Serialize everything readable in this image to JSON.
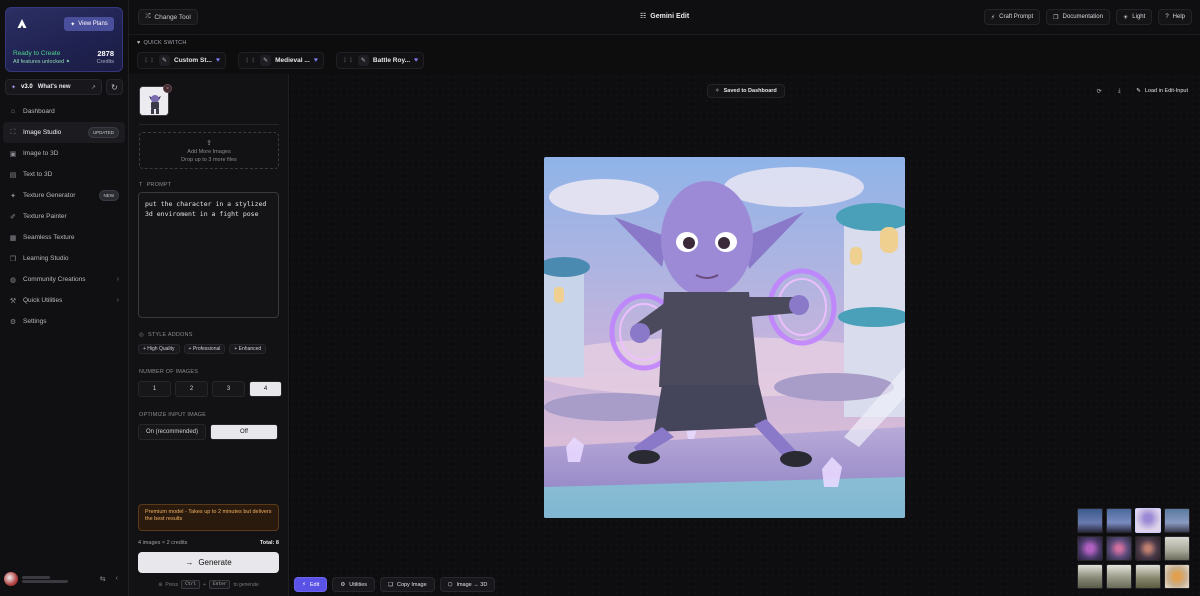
{
  "sidebar": {
    "plan": {
      "view_plans": "View Plans",
      "status": "Ready to Create",
      "features": "All features unlocked",
      "credits_value": "2878",
      "credits_label": "Credits"
    },
    "version": {
      "label": "v3.0",
      "whats_new": "What's new"
    },
    "nav": [
      {
        "label": "Dashboard",
        "icon": "home-icon"
      },
      {
        "label": "Image Studio",
        "icon": "image-studio-icon",
        "badge": "UPDATED",
        "active": true
      },
      {
        "label": "Image to 3D",
        "icon": "image-icon"
      },
      {
        "label": "Text to 3D",
        "icon": "document-icon"
      },
      {
        "label": "Texture Generator",
        "icon": "sparkle-icon",
        "badge": "NEW"
      },
      {
        "label": "Texture Painter",
        "icon": "brush-icon"
      },
      {
        "label": "Seamless Texture",
        "icon": "grid-icon"
      },
      {
        "label": "Learning Studio",
        "icon": "book-icon"
      },
      {
        "label": "Community Creations",
        "icon": "globe-icon",
        "chevron": true
      },
      {
        "label": "Quick Utilities",
        "icon": "tool-icon",
        "chevron": true
      },
      {
        "label": "Settings",
        "icon": "gear-icon"
      }
    ]
  },
  "header": {
    "change_tool": "Change Tool",
    "title": "Gemini Edit",
    "actions": [
      {
        "label": "Craft Prompt",
        "icon": "wand-icon"
      },
      {
        "label": "Documentation",
        "icon": "book-icon"
      },
      {
        "label": "Light",
        "icon": "sun-icon"
      },
      {
        "label": "Help",
        "icon": "help-icon"
      }
    ]
  },
  "quick_switch": {
    "label": "QUICK SWITCH",
    "items": [
      "Custom St...",
      "Medieval ...",
      "Battle Roy..."
    ]
  },
  "panel": {
    "dropzone_title": "Add More Images",
    "dropzone_sub": "Drop up to 3 more files",
    "prompt_label": "PROMPT",
    "prompt_value": "put the character in a stylized 3d enviroment in a fight pose",
    "style_label": "STYLE ADDONS",
    "addons": [
      "+ High Quality",
      "+ Professional",
      "+ Enhanced"
    ],
    "num_label": "NUMBER OF IMAGES",
    "num_options": [
      "1",
      "2",
      "3",
      "4"
    ],
    "num_selected": "4",
    "optimize_label": "OPTIMIZE INPUT IMAGE",
    "optimize_options": [
      "On (recommended)",
      "Off"
    ],
    "optimize_selected": "Off",
    "premium_note": "Premium model - Takes up to 2 minutes but delivers the best results",
    "cost": "4 images × 2 credits",
    "total": "Total: 8",
    "generate": "Generate",
    "hint_press": "Press",
    "hint_ctrl": "Ctrl",
    "hint_plus": "+",
    "hint_enter": "Enter",
    "hint_tail": "to generate"
  },
  "canvas": {
    "saved": "Saved to Dashboard",
    "load_edit": "Load in Edit-Input",
    "bottom": [
      {
        "label": "Edit",
        "icon": "wand-icon",
        "primary": true
      },
      {
        "label": "Utilities",
        "icon": "gear-icon"
      },
      {
        "label": "Copy Image",
        "icon": "copy-icon"
      },
      {
        "label": "Image → 3D",
        "icon": "cube-icon"
      }
    ]
  },
  "colors": {
    "accent": "#5a52e6",
    "ready": "#4fd48b",
    "premium_text": "#f0b060"
  }
}
